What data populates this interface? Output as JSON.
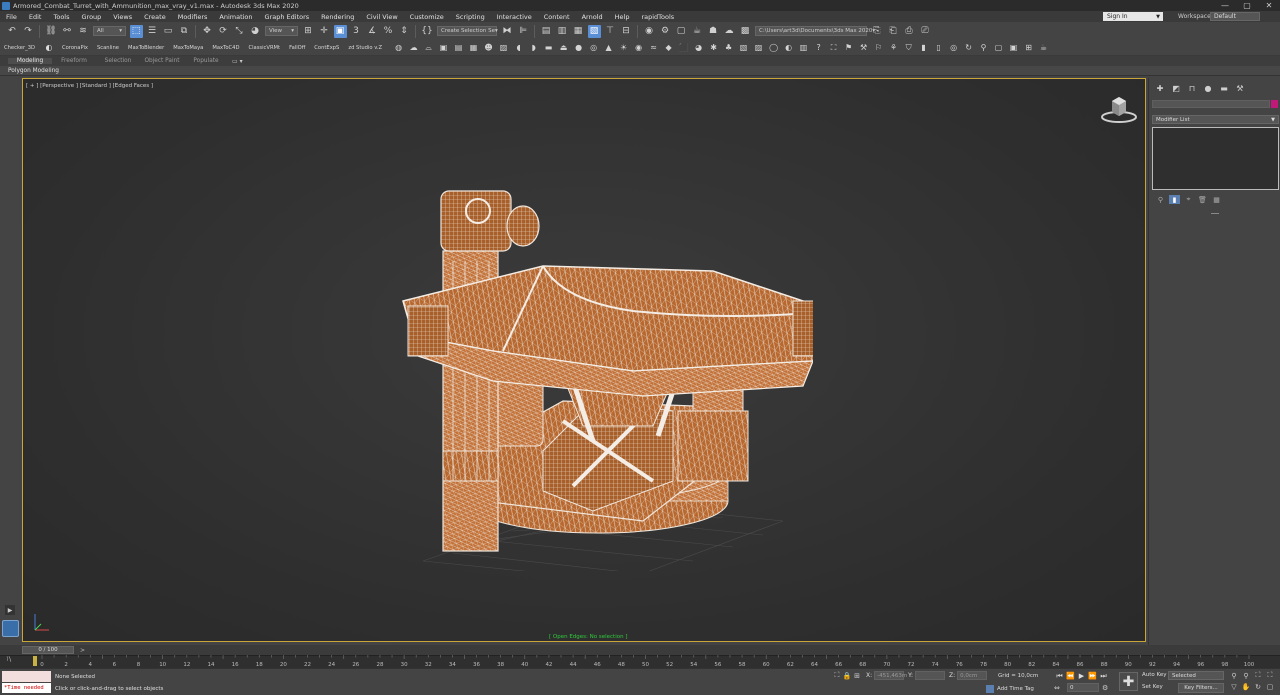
{
  "window": {
    "title": "Armored_Combat_Turret_with_Ammunition_max_vray_v1.max - Autodesk 3ds Max 2020",
    "minimize": "—",
    "maximize": "▢",
    "close": "✕"
  },
  "menu": {
    "items": [
      "File",
      "Edit",
      "Tools",
      "Group",
      "Views",
      "Create",
      "Modifiers",
      "Animation",
      "Graph Editors",
      "Rendering",
      "Civil View",
      "Customize",
      "Scripting",
      "Interactive",
      "Content",
      "Arnold",
      "Help",
      "rapidTools"
    ],
    "sign_in": "Sign In",
    "workspaces_label": "Workspaces:",
    "workspace": "Default"
  },
  "toolbar": {
    "filter": "All",
    "ref_coord": "View",
    "selection_set": "Create Selection Se",
    "project_path": "C:\\Users\\art3d\\Documents\\3ds Max 2020"
  },
  "plugins": {
    "items": [
      "Checker_3D",
      "CoronaPix",
      "Scanline",
      "MaxToBlender",
      "MaxToMaya",
      "MaxToC4D",
      "ClassicVRMt",
      "FallOff",
      "ContExpS",
      "zd Studio v.Z"
    ]
  },
  "ribbon": {
    "tabs": [
      "Modeling",
      "Freeform",
      "Selection",
      "Object Paint",
      "Populate"
    ],
    "more": "▭ ▾",
    "panel": "Polygon Modeling"
  },
  "viewport": {
    "label": "[ + ] [Perspective ] [Standard ] [Edged Faces ]",
    "status": "[ Open Edges: No selection ]"
  },
  "command_panel": {
    "modifier_list": "Modifier List"
  },
  "timeline": {
    "time_slider": "0 / 100",
    "ticks": [
      "0",
      "2",
      "4",
      "6",
      "8",
      "10",
      "12",
      "14",
      "16",
      "18",
      "20",
      "22",
      "24",
      "26",
      "28",
      "30",
      "32",
      "34",
      "36",
      "38",
      "40",
      "42",
      "44",
      "46",
      "48",
      "50",
      "52",
      "54",
      "56",
      "58",
      "60",
      "62",
      "64",
      "66",
      "68",
      "70",
      "72",
      "74",
      "76",
      "78",
      "80",
      "82",
      "84",
      "86",
      "88",
      "90",
      "92",
      "94",
      "96",
      "98",
      "100"
    ]
  },
  "status": {
    "maxscript_output": "*Time needed",
    "selection": "None Selected",
    "prompt": "Click or click-and-drag to select objects",
    "x_label": "X:",
    "x_value": "-451,463m",
    "y_label": "Y:",
    "y_value": "",
    "z_label": "Z:",
    "z_value": "0,0cm",
    "grid": "Grid = 10,0cm",
    "add_time_tag": "Add Time Tag",
    "frame": "0",
    "auto_key": "Auto Key",
    "set_key": "Set Key",
    "key_mode": "Selected",
    "key_filters": "Key Filters..."
  }
}
